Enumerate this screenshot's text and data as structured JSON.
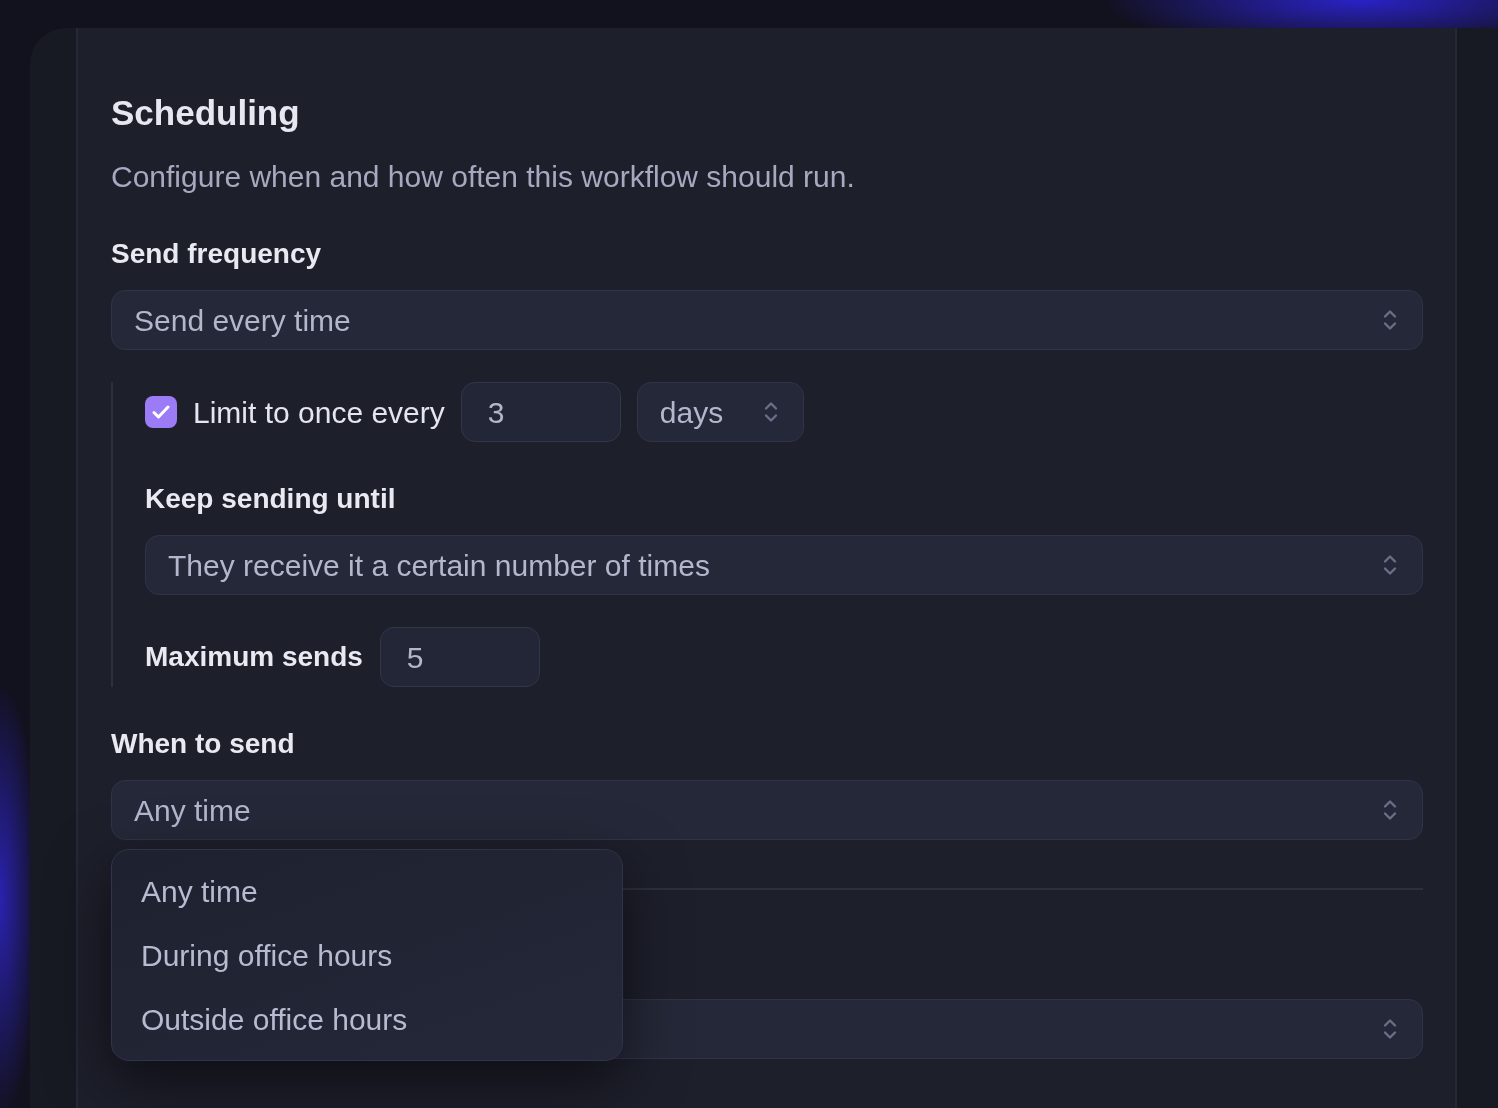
{
  "section": {
    "title": "Scheduling",
    "description": "Configure when and how often this workflow should run."
  },
  "send_frequency": {
    "label": "Send frequency",
    "value": "Send every time"
  },
  "limit": {
    "checked": true,
    "label": "Limit to once every",
    "interval": "3",
    "unit": "days"
  },
  "keep_sending_until": {
    "label": "Keep sending until",
    "value": "They receive it a certain number of times"
  },
  "maximum_sends": {
    "label": "Maximum sends",
    "value": "5"
  },
  "when_to_send": {
    "label": "When to send",
    "value": "Any time",
    "menu": {
      "open": true,
      "options": [
        "Any time",
        "During office hours",
        "Outside office hours"
      ]
    }
  }
}
